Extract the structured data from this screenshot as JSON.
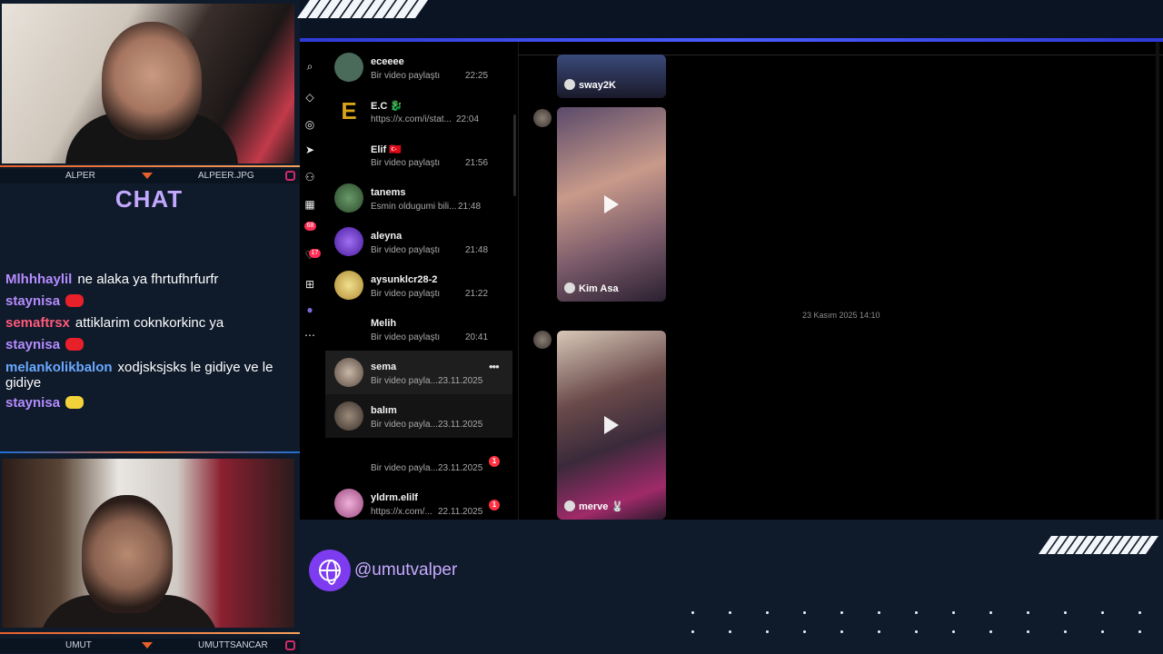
{
  "overlay": {
    "top_cam": {
      "name_left": "ALPER",
      "name_right": "ALPEER.JPG"
    },
    "bottom_cam": {
      "name_left": "UMUT",
      "name_right": "UMUTTSANCAR"
    },
    "chat_title": "CHAT",
    "chat_messages": [
      {
        "user": "Mlhhhaylil",
        "user_color": "#b48cff",
        "text": "ne alaka ya fhrtufhrfurfr"
      },
      {
        "user": "staynisa",
        "user_color": "#b48cff",
        "text": "",
        "emote": "red-emote"
      },
      {
        "user": "semaftrsx",
        "user_color": "#ff5a7a",
        "text": "attiklarim coknkorkinc ya"
      },
      {
        "user": "staynisa",
        "user_color": "#b48cff",
        "text": "",
        "emote": "red-emote"
      },
      {
        "user": "melankolikbalon",
        "user_color": "#6aa8ff",
        "text": "xodjsksjsks le gidiye ve le gidiye"
      },
      {
        "user": "staynisa",
        "user_color": "#b48cff",
        "text": "",
        "emote": "yellow-emote"
      }
    ],
    "handle": "@umutvalper"
  },
  "dm_list": [
    {
      "name": "eceeee",
      "sub": "Bir video paylaştı",
      "time": "22:25",
      "avatar": "#4a6a5a"
    },
    {
      "name": "E.C 🐉",
      "sub": "https://x.com/i/stat...",
      "time": "22:04",
      "avatar": "#d8a21a"
    },
    {
      "name": "Elif 🇹🇷",
      "sub": "Bir video paylaştı",
      "time": "21:56",
      "avatar": "#000000"
    },
    {
      "name": "tanems",
      "sub": "Esmin oldugumi bili...",
      "time": "21:48",
      "avatar": "#4a7a4a"
    },
    {
      "name": "aleyna",
      "sub": "Bir video paylaştı",
      "time": "21:48",
      "avatar": "#7a3ad0"
    },
    {
      "name": "aysunklcr28-2",
      "sub": "Bir video paylaştı",
      "time": "21:22",
      "avatar": "#e8c860"
    },
    {
      "name": "Melih",
      "sub": "Bir video paylaştı",
      "time": "20:41",
      "avatar": "#000000"
    },
    {
      "name": "sema",
      "sub": "Bir video payla...",
      "time": "23.11.2025",
      "avatar": "#8a7a70",
      "hover": true
    },
    {
      "name": "balım",
      "sub": "Bir video payla...",
      "time": "23.11.2025",
      "avatar": "#6a6058"
    },
    {
      "name": "",
      "sub": "Bir video payla...",
      "time": "23.11.2025",
      "avatar": "#000000",
      "unread": "1"
    },
    {
      "name": "yldrm.elilf",
      "sub": "https://x.com/...",
      "time": "22.11.2025",
      "avatar": "#d87ab0",
      "unread": "1"
    }
  ],
  "rail_badges": [
    "68",
    "17"
  ],
  "conversation": {
    "reels": [
      {
        "caption": "sway2K"
      },
      {
        "caption": "Kim Asa"
      },
      {
        "caption": "merve 🐰"
      }
    ],
    "date_separator": "23 Kasım 2025 14:10"
  }
}
